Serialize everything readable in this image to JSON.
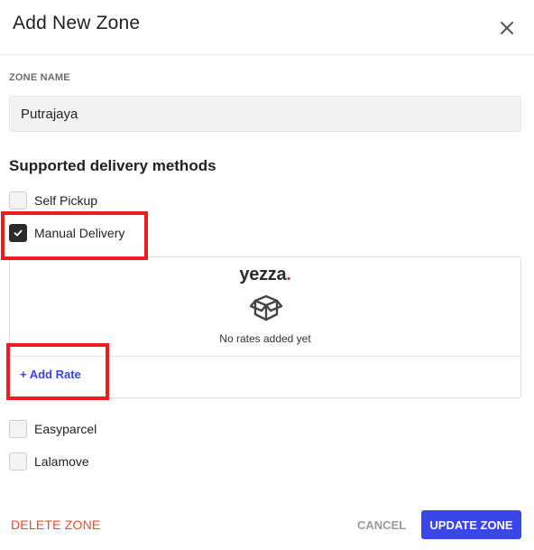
{
  "modal": {
    "title": "Add New Zone"
  },
  "zone_name": {
    "label": "ZONE NAME",
    "value": "Putrajaya"
  },
  "delivery": {
    "title": "Supported delivery methods",
    "methods": [
      {
        "label": "Self Pickup",
        "checked": false
      },
      {
        "label": "Manual Delivery",
        "checked": true
      },
      {
        "label": "Easyparcel",
        "checked": false
      },
      {
        "label": "Lalamove",
        "checked": false
      }
    ],
    "rates": {
      "logo_text": "yezza",
      "logo_dot": ".",
      "empty_text": "No rates added yet",
      "add_label": "+ Add Rate"
    }
  },
  "footer": {
    "delete_label": "DELETE ZONE",
    "cancel_label": "CANCEL",
    "update_label": "UPDATE ZONE"
  },
  "colors": {
    "accent": "#3b46e8",
    "danger": "#f0462e",
    "highlight": "#ee1c1c",
    "brand_dot": "#e0245e"
  }
}
